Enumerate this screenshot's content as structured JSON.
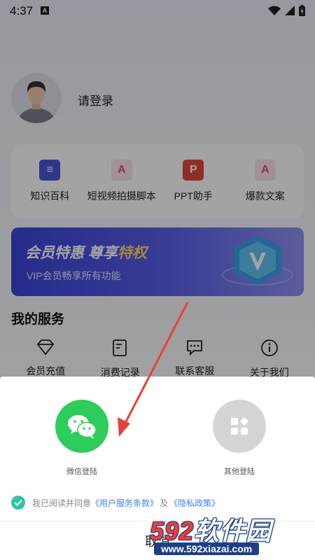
{
  "status": {
    "time": "4:37",
    "notif_badge": "A"
  },
  "profile": {
    "login": "请登录"
  },
  "tools": [
    {
      "label": "知识百科",
      "icon": "book-icon",
      "glyph": "S",
      "color": "#4b55d6"
    },
    {
      "label": "短视频拍摄脚本",
      "icon": "doc-a-icon",
      "glyph": "A",
      "color": "#e0488f"
    },
    {
      "label": "PPT助手",
      "icon": "ppt-icon",
      "glyph": "P",
      "color": "#e0483a"
    },
    {
      "label": "爆款文案",
      "icon": "doc-a-icon",
      "glyph": "A",
      "color": "#e0488f"
    }
  ],
  "vip": {
    "title_a": "会员特惠 尊享",
    "title_b": "特权",
    "subtitle": "VIP会员畅享所有功能"
  },
  "services": {
    "title": "我的服务",
    "items": [
      {
        "label": "会员充值",
        "icon": "diamond-icon"
      },
      {
        "label": "消费记录",
        "icon": "receipt-icon"
      },
      {
        "label": "联系客服",
        "icon": "chat-icon"
      },
      {
        "label": "关于我们",
        "icon": "info-icon"
      }
    ]
  },
  "sheet": {
    "wechat_label": "微信登陆",
    "other_label": "其他登陆",
    "agree_prefix": "我已阅读并同意",
    "terms_link": "《用户服务条款》",
    "and": "及",
    "privacy_link": "《隐私政策》",
    "cancel": "取消",
    "colors": {
      "wechat": "#2ecc5a",
      "other": "#d3d4d6",
      "check": "#2fc4a2",
      "link": "#3b82f6"
    }
  },
  "watermark": {
    "num": "592",
    "name": "软件园",
    "url": "www.592xiazai.com"
  }
}
